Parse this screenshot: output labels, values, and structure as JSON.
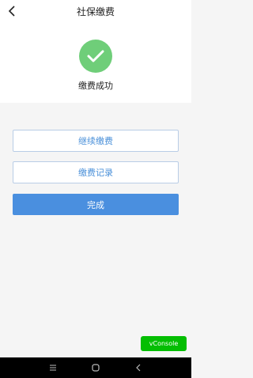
{
  "header": {
    "title": "社保缴费",
    "back_icon": "chevron-left-icon"
  },
  "status": {
    "icon": "check-icon",
    "icon_color": "#6fce79",
    "text": "缴费成功"
  },
  "buttons": {
    "continue_label": "继续缴费",
    "record_label": "缴费记录",
    "done_label": "完成"
  },
  "colors": {
    "accent": "#4a8fdf",
    "vconsole": "#04be02"
  },
  "vconsole": {
    "label": "vConsole"
  },
  "navbar": {
    "icons": [
      "menu-icon",
      "home-icon",
      "back-icon"
    ]
  }
}
